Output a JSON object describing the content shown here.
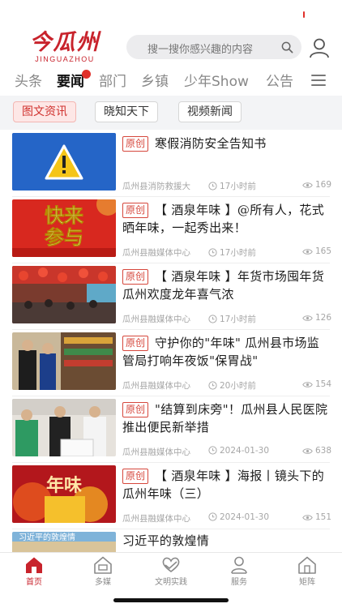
{
  "app": {
    "logo_text": "今瓜州",
    "logo_subtext": "JINGUAZHOU",
    "accent_color": "#c8232c"
  },
  "search": {
    "placeholder": "搜一搜你感兴趣的内容",
    "icon": "search-icon"
  },
  "channels": [
    {
      "label": "头条",
      "active": false
    },
    {
      "label": "要闻",
      "active": true
    },
    {
      "label": "部门",
      "active": false
    },
    {
      "label": "乡镇",
      "active": false
    },
    {
      "label": "少年Show",
      "active": false
    },
    {
      "label": "公告",
      "active": false
    }
  ],
  "subtabs": [
    {
      "label": "图文资讯",
      "active": true
    },
    {
      "label": "晓知天下",
      "active": false
    },
    {
      "label": "视频新闻",
      "active": false
    }
  ],
  "news": [
    {
      "badge": "原创",
      "title": "寒假消防安全告知书",
      "source": "瓜州县消防救援大",
      "time": "17小时前",
      "views": "169",
      "thumb": "fire-safety-warning"
    },
    {
      "badge": "原创",
      "title": "【 酒泉年味 】@所有人，花式晒年味，一起秀出来！",
      "source": "瓜州县融媒体中心",
      "time": "17小时前",
      "views": "165",
      "thumb": "kuai-lai-can-yu-banner",
      "thumb_text": "快来参与"
    },
    {
      "badge": "原创",
      "title": "【 酒泉年味 】年货市场囤年货  瓜州欢度龙年喜气浓",
      "source": "瓜州县融媒体中心",
      "time": "17小时前",
      "views": "126",
      "thumb": "new-year-market"
    },
    {
      "badge": "原创",
      "title": "守护你的\"年味\" 瓜州县市场监管局打响年夜饭\"保胃战\"",
      "source": "瓜州县融媒体中心",
      "time": "20小时前",
      "views": "154",
      "thumb": "market-inspection"
    },
    {
      "badge": "原创",
      "title": "\"结算到床旁\"！瓜州县人民医院推出便民新举措",
      "source": "瓜州县融媒体中心",
      "time": "2024-01-30",
      "views": "638",
      "thumb": "hospital-service"
    },
    {
      "badge": "原创",
      "title": "【 酒泉年味 】海报丨镜头下的瓜州年味（三）",
      "source": "瓜州县融媒体中心",
      "time": "2024-01-30",
      "views": "151",
      "thumb": "nian-wei-poster",
      "thumb_text": "年味"
    },
    {
      "badge": "",
      "title": "习近平的敦煌情",
      "source": "",
      "time": "",
      "views": "",
      "thumb": "dunhuang",
      "thumb_text": "习近平的敦煌情"
    }
  ],
  "bottom_nav": [
    {
      "label": "首页",
      "icon": "home-icon",
      "active": true
    },
    {
      "label": "多媒",
      "icon": "media-house-icon",
      "active": false
    },
    {
      "label": "文明实践",
      "icon": "heart-hands-icon",
      "active": false
    },
    {
      "label": "服务",
      "icon": "service-icon",
      "active": false
    },
    {
      "label": "矩阵",
      "icon": "matrix-house-icon",
      "active": false
    }
  ]
}
